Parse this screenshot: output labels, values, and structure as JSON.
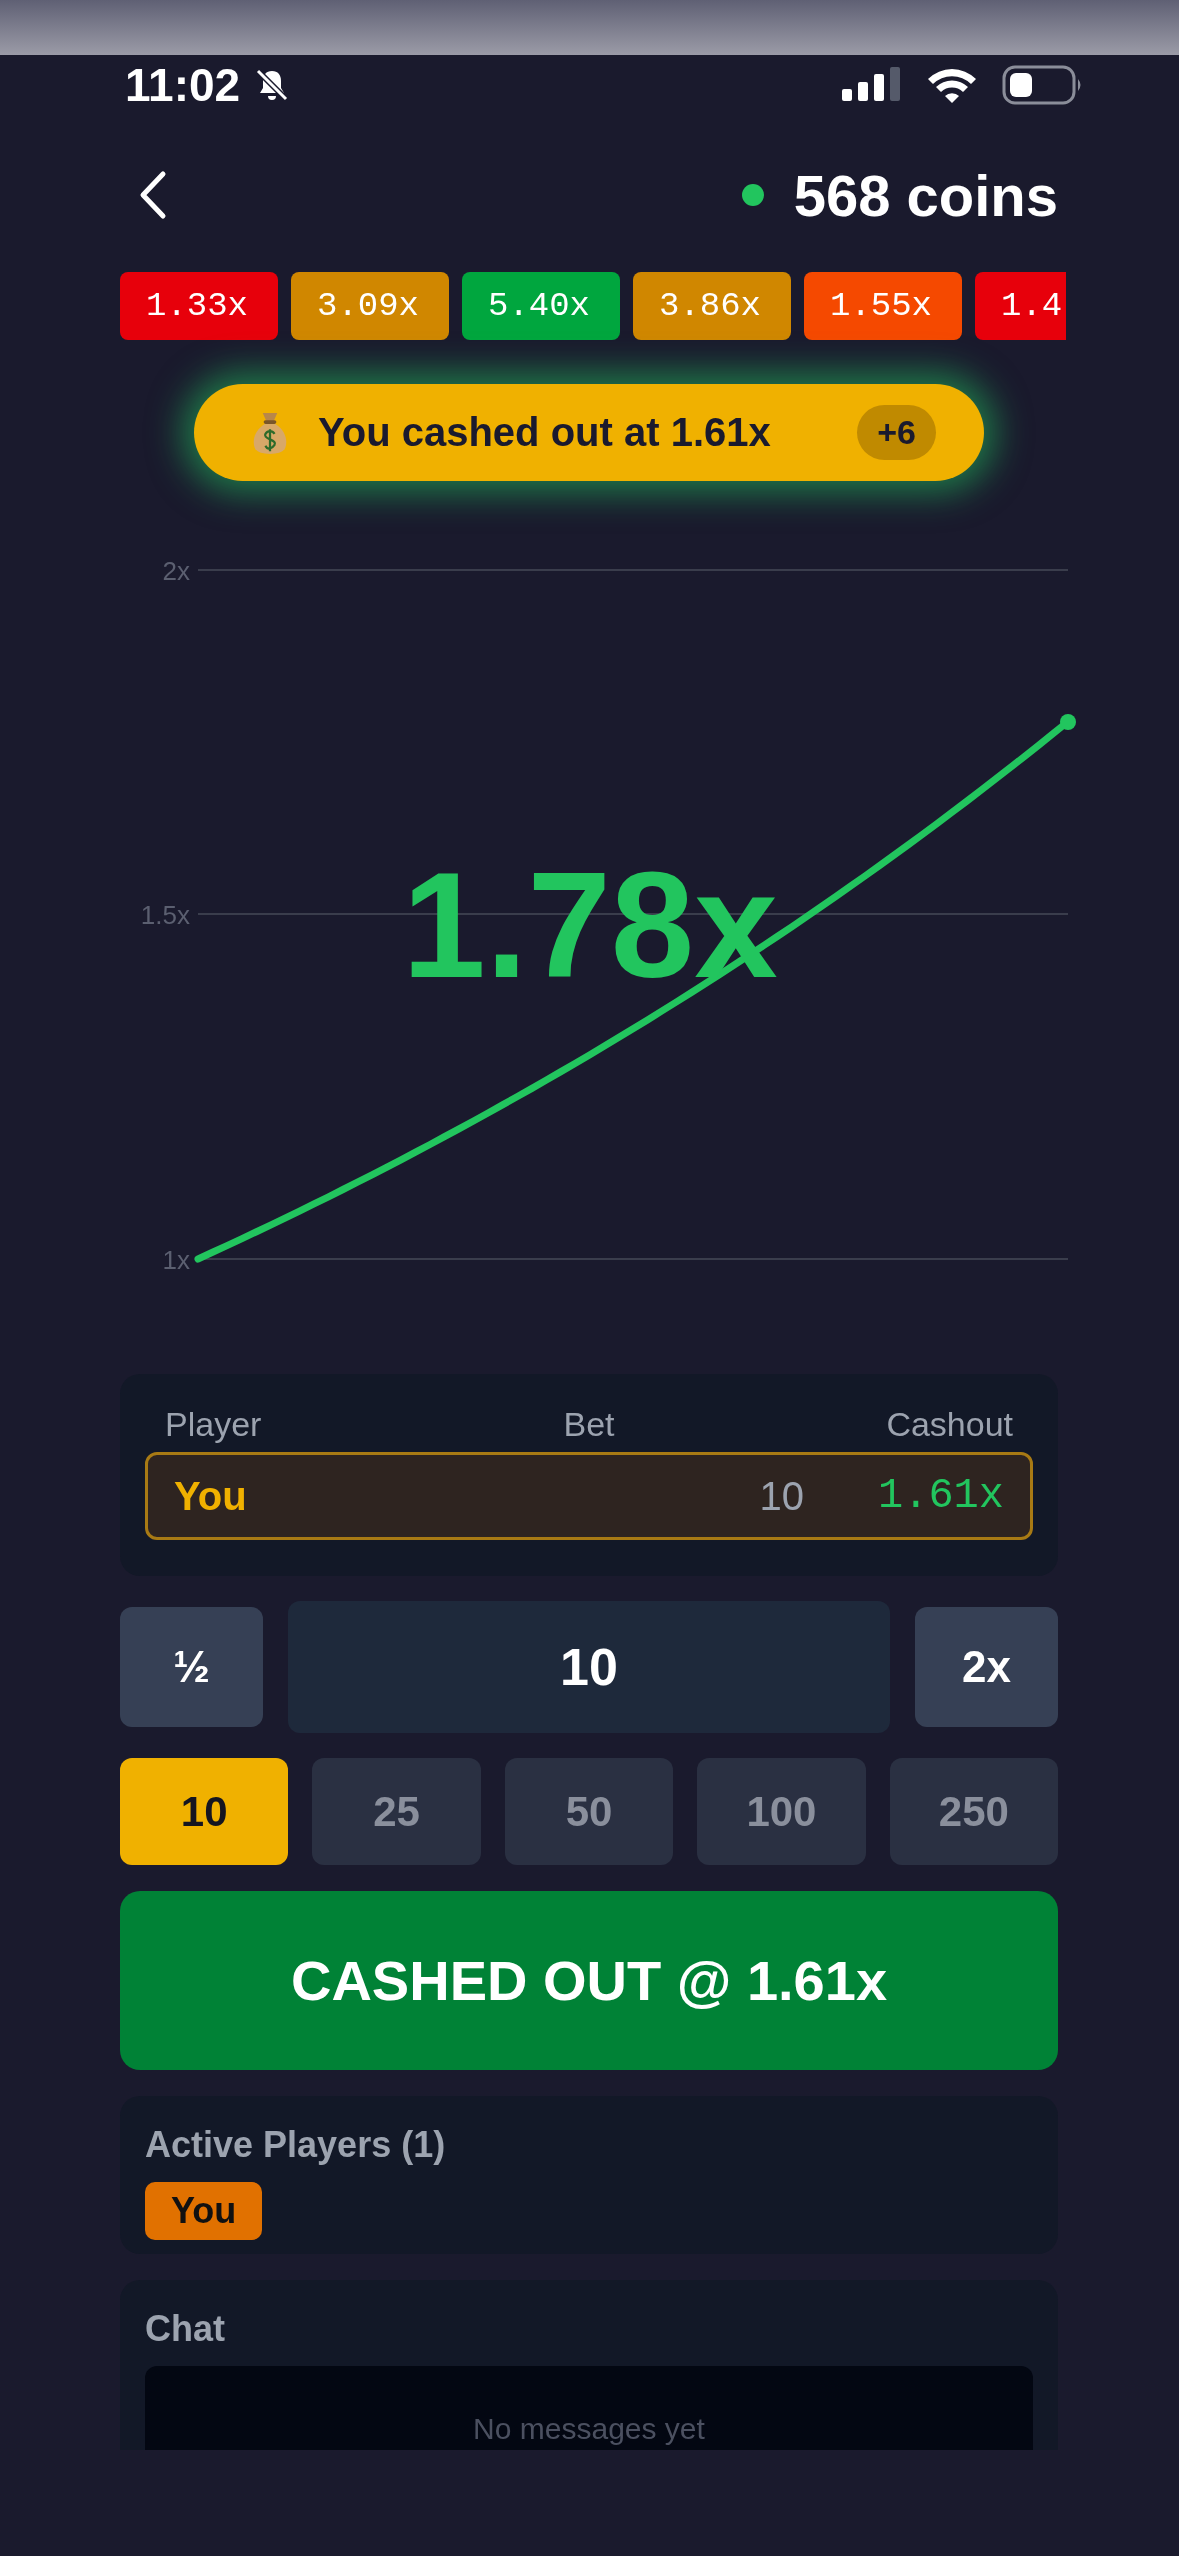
{
  "status_bar": {
    "time": "11:02"
  },
  "header": {
    "online": true,
    "balance": "568 coins"
  },
  "history": [
    {
      "value": "1.33x",
      "color": "#e7000b"
    },
    {
      "value": "3.09x",
      "color": "#d08700"
    },
    {
      "value": "5.40x",
      "color": "#00a63e"
    },
    {
      "value": "3.86x",
      "color": "#d08700"
    },
    {
      "value": "1.55x",
      "color": "#f54900"
    },
    {
      "value": "1.4",
      "color": "#e7000b"
    }
  ],
  "toast": {
    "text": "You cashed out at **1.61x**",
    "badge": "+6"
  },
  "chart": {
    "y_labels": [
      "2x",
      "1.5x",
      "1x"
    ],
    "multiplier": "1.78x"
  },
  "bets_table": {
    "columns": [
      "Player",
      "Bet",
      "Cashout"
    ],
    "rows": [
      {
        "player": "You",
        "bet": "10",
        "cashout": "1.61x",
        "highlighted": true
      }
    ]
  },
  "bet_controls": {
    "half": "½",
    "amount": "10",
    "double": "2x"
  },
  "quick_amounts": [
    {
      "label": "10",
      "selected": true
    },
    {
      "label": "25",
      "selected": false
    },
    {
      "label": "50",
      "selected": false
    },
    {
      "label": "100",
      "selected": false
    },
    {
      "label": "250",
      "selected": false
    }
  ],
  "action_button": "CASHED OUT @ 1.61x",
  "active_players": {
    "title": "Active Players (1)",
    "players": [
      "You"
    ]
  },
  "chat": {
    "title": "Chat",
    "empty_message": "No messages yet"
  }
}
